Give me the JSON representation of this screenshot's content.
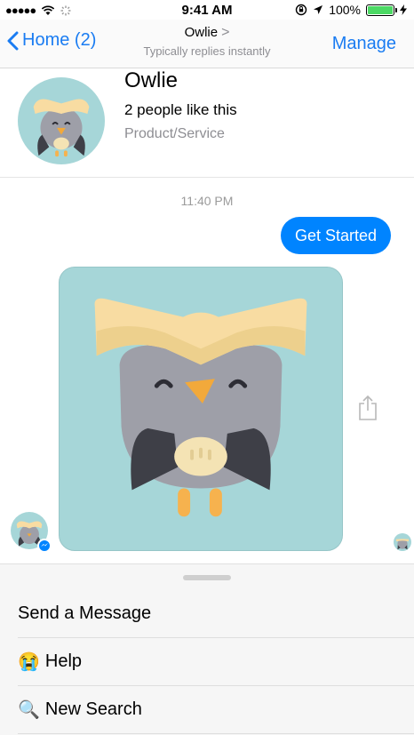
{
  "status_bar": {
    "time": "9:41 AM",
    "battery": "100%",
    "signal_dots": "●●●●●"
  },
  "nav": {
    "back_label": "Home (2)",
    "title": "Owlie",
    "title_chevron": ">",
    "subtitle": "Typically replies instantly",
    "manage_label": "Manage"
  },
  "profile": {
    "name": "Owlie",
    "likes": "2 people like this",
    "category": "Product/Service"
  },
  "conversation": {
    "timestamp": "11:40 PM",
    "sent_message": "Get Started"
  },
  "menu": {
    "items": [
      {
        "label": "Send a Message",
        "icon": ""
      },
      {
        "label": "Help",
        "icon": "😭"
      },
      {
        "label": "New Search",
        "icon": "🔍"
      }
    ]
  },
  "colors": {
    "accent": "#0084ff",
    "link": "#1a7cf2",
    "owl_bg": "#a6d6d8"
  }
}
